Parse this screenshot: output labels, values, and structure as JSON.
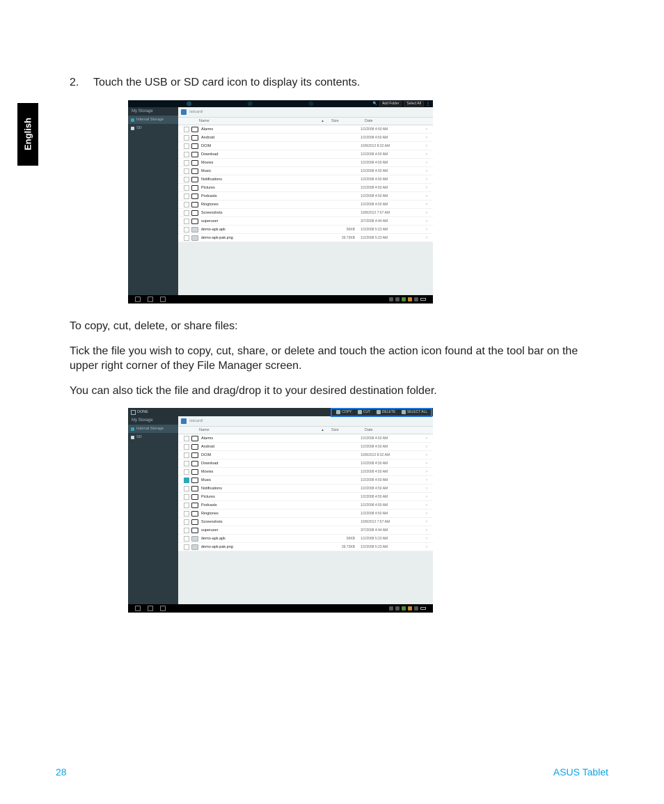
{
  "side_tab": "English",
  "step": {
    "num": "2.",
    "text": "Touch the USB or SD card icon to display its contents."
  },
  "para1": "To copy, cut, delete, or share files:",
  "para2": "Tick the file you wish to copy, cut, share, or delete and touch the action icon found at the tool bar on the upper right corner of they File Manager screen.",
  "para3": "You can also tick the file and drag/drop it to your desired destination folder.",
  "footer": {
    "page": "28",
    "brand": "ASUS Tablet"
  },
  "shot1": {
    "status_chips": [
      "Add Folder",
      "Select All"
    ],
    "sidebar_title": "My Storage",
    "sidebar_items": [
      {
        "label": "Internal Storage",
        "bullet": "cyan",
        "active": true
      },
      {
        "label": "SD",
        "bullet": "white",
        "active": false
      }
    ],
    "breadcrumb_path": "/sdcard/",
    "columns": {
      "name": "Name",
      "sort_indicator": "▲",
      "size": "Size",
      "date": "Date"
    },
    "rows": [
      {
        "type": "folder",
        "name": "Alarms",
        "size": "",
        "date": "1/2/2008 4:50 AM"
      },
      {
        "type": "folder",
        "name": "Android",
        "size": "",
        "date": "1/2/2008 4:50 AM"
      },
      {
        "type": "folder",
        "name": "DCIM",
        "size": "",
        "date": "10/8/2012 8:32 AM"
      },
      {
        "type": "folder",
        "name": "Download",
        "size": "",
        "date": "1/2/2008 4:50 AM"
      },
      {
        "type": "folder",
        "name": "Movies",
        "size": "",
        "date": "1/2/2008 4:50 AM"
      },
      {
        "type": "folder",
        "name": "Music",
        "size": "",
        "date": "1/2/2008 4:50 AM"
      },
      {
        "type": "folder",
        "name": "Notifications",
        "size": "",
        "date": "1/2/2008 4:50 AM"
      },
      {
        "type": "folder",
        "name": "Pictures",
        "size": "",
        "date": "1/2/2008 4:50 AM"
      },
      {
        "type": "folder",
        "name": "Podcasts",
        "size": "",
        "date": "1/2/2008 4:50 AM"
      },
      {
        "type": "folder",
        "name": "Ringtones",
        "size": "",
        "date": "1/2/2008 4:50 AM"
      },
      {
        "type": "folder",
        "name": "Screenshots",
        "size": "",
        "date": "10/8/2012 7:57 AM"
      },
      {
        "type": "folder",
        "name": "superuser",
        "size": "",
        "date": "3/7/2008 4:44 AM"
      },
      {
        "type": "file",
        "name": "demo-apk.apk",
        "size": "56KB",
        "date": "1/2/2008 5:23 AM"
      },
      {
        "type": "file",
        "name": "demo-apk-pak.png",
        "size": "39.73KB",
        "date": "1/2/2008 5:23 AM"
      }
    ]
  },
  "shot2": {
    "action_done": "DONE",
    "actions": [
      {
        "label": "COPY"
      },
      {
        "label": "CUT"
      },
      {
        "label": "DELETE"
      },
      {
        "label": "SELECT ALL"
      }
    ],
    "sidebar_title": "My Storage",
    "sidebar_items": [
      {
        "label": "Internal Storage",
        "bullet": "cyan",
        "active": true
      },
      {
        "label": "SD",
        "bullet": "white",
        "active": false
      }
    ],
    "breadcrumb_path": "/sdcard/",
    "columns": {
      "name": "Name",
      "sort_indicator": "▲",
      "size": "Size",
      "date": "Date"
    },
    "rows": [
      {
        "type": "folder",
        "checked": false,
        "name": "Alarms",
        "size": "",
        "date": "1/2/2008 4:50 AM"
      },
      {
        "type": "folder",
        "checked": false,
        "name": "Android",
        "size": "",
        "date": "1/2/2008 4:50 AM"
      },
      {
        "type": "folder",
        "checked": false,
        "name": "DCIM",
        "size": "",
        "date": "10/8/2012 8:32 AM"
      },
      {
        "type": "folder",
        "checked": false,
        "name": "Download",
        "size": "",
        "date": "1/2/2008 4:50 AM"
      },
      {
        "type": "folder",
        "checked": false,
        "name": "Movies",
        "size": "",
        "date": "1/2/2008 4:50 AM"
      },
      {
        "type": "folder",
        "checked": true,
        "name": "Music",
        "size": "",
        "date": "1/2/2008 4:50 AM"
      },
      {
        "type": "folder",
        "checked": false,
        "name": "Notifications",
        "size": "",
        "date": "1/2/2008 4:50 AM"
      },
      {
        "type": "folder",
        "checked": false,
        "name": "Pictures",
        "size": "",
        "date": "1/2/2008 4:50 AM"
      },
      {
        "type": "folder",
        "checked": false,
        "name": "Podcasts",
        "size": "",
        "date": "1/2/2008 4:50 AM"
      },
      {
        "type": "folder",
        "checked": false,
        "name": "Ringtones",
        "size": "",
        "date": "1/2/2008 4:50 AM"
      },
      {
        "type": "folder",
        "checked": false,
        "name": "Screenshots",
        "size": "",
        "date": "10/8/2012 7:57 AM"
      },
      {
        "type": "folder",
        "checked": false,
        "name": "superuser",
        "size": "",
        "date": "3/7/2008 4:44 AM"
      },
      {
        "type": "file",
        "checked": false,
        "name": "demo-apk.apk",
        "size": "56KB",
        "date": "1/2/2008 5:23 AM"
      },
      {
        "type": "file",
        "checked": false,
        "name": "demo-apk-pak.png",
        "size": "39.73KB",
        "date": "1/2/2008 5:23 AM"
      }
    ]
  }
}
